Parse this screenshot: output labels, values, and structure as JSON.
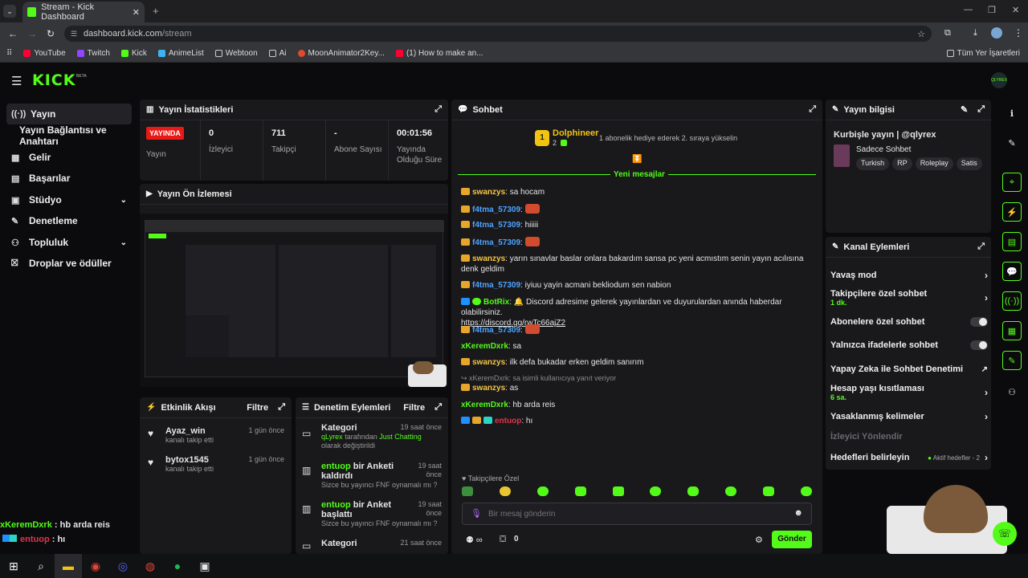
{
  "browser": {
    "tab_title": "Stream - Kick Dashboard",
    "url_domain": "dashboard.kick.com",
    "url_path": "/stream",
    "bookmarks": [
      "YouTube",
      "Twitch",
      "Kick",
      "AnimeList",
      "Webtoon",
      "Ai",
      "MoonAnimator2Key...",
      "(1) How to make an..."
    ],
    "bookmarks_right": "Tüm Yer İşaretleri"
  },
  "header": {
    "logo": "KICK",
    "beta": "BETA",
    "avatar": "QLYREX"
  },
  "sidebar": {
    "items": [
      "Yayın",
      "Yayın Bağlantısı ve Anahtarı",
      "Gelir",
      "Başarılar",
      "Stüdyo",
      "Denetleme",
      "Topluluk",
      "Droplar ve ödüller"
    ]
  },
  "stats": {
    "title": "Yayın İstatistikleri",
    "live_badge": "YAYINDA",
    "live_label": "Yayın",
    "viewers_value": "0",
    "viewers_label": "İzleyici",
    "followers_value": "711",
    "followers_label": "Takipçi",
    "subs_value": "-",
    "subs_label": "Abone Sayısı",
    "uptime_value": "00:01:56",
    "uptime_label": "Yayında Olduğu Süre"
  },
  "preview": {
    "title": "Yayın Ön İzlemesi"
  },
  "activity": {
    "title": "Etkinlik Akışı",
    "filter": "Filtre",
    "items": [
      {
        "user": "Ayaz_win",
        "desc": "kanalı takip etti",
        "time": "1 gün önce"
      },
      {
        "user": "bytox1545",
        "desc": "kanalı takip etti",
        "time": "1 gün önce"
      }
    ]
  },
  "moderation": {
    "title": "Denetim Eylemleri",
    "filter": "Filtre",
    "items": [
      {
        "title": "Kategori",
        "time": "19 saat önce",
        "l1a": "qLyrex",
        "l1b": " tarafından ",
        "l1c": "Just Chatting",
        "l1d": " olarak değiştirildi"
      },
      {
        "user": "entuop",
        "title": " bir Anketi kaldırdı",
        "time": "19 saat önce",
        "sub": "Sizce bu yayıncı FNF oynamalı mı ?"
      },
      {
        "user": "entuop",
        "title": " bir Anket başlattı",
        "time": "19 saat önce",
        "sub": "Sizce bu yayıncı FNF oynamalı mı ?"
      },
      {
        "title": "Kategori",
        "time": "21 saat önce"
      }
    ]
  },
  "chat": {
    "title": "Sohbet",
    "pinned_user": "Dolphineer",
    "pinned_num": "2",
    "gift_rank": "1",
    "pinned_text": "1 abonelik hediye ederek 2. sıraya yükselin",
    "new_messages": "Yeni mesajlar",
    "messages": [
      {
        "user": "swanzys",
        "color": "#f5c542",
        "text": "sa hocam"
      },
      {
        "user": "f4tma_57309",
        "color": "#4fa3ff",
        "text": ""
      },
      {
        "user": "f4tma_57309",
        "color": "#4fa3ff",
        "text": "hiiiii"
      },
      {
        "user": "f4tma_57309",
        "color": "#4fa3ff",
        "text": ""
      },
      {
        "user": "swanzys",
        "color": "#f5c542",
        "text": "yarın sınavlar baslar onlara bakardım sansa pc yeni acmıstım senin yayın acılısına denk geldim"
      },
      {
        "user": "f4tma_57309",
        "color": "#4fa3ff",
        "text": "iyiuu yayin acmani bekliodum sen nabion"
      },
      {
        "user": "BotRix",
        "color": "#53fc18",
        "text": "Discord adresime gelerek yayınlardan ve duyurulardan anında haberdar olabilirsiniz.",
        "link": "https://discord.gg/rwTc66ajZ2"
      },
      {
        "user": "f4tma_57309",
        "color": "#4fa3ff",
        "text": ""
      },
      {
        "user": "xKeremDxrk",
        "color": "#53fc18",
        "text": "sa"
      },
      {
        "user": "swanzys",
        "color": "#f5c542",
        "text": "ilk defa bukadar erken geldim sanırım"
      },
      {
        "user": "swanzys",
        "color": "#f5c542",
        "text": "as",
        "reply": "xKeremDxrk: sa isimli kullanıcıya yanıt veriyor"
      },
      {
        "user": "xKeremDxrk",
        "color": "#53fc18",
        "text": "hb arda reis"
      },
      {
        "user": "entuop",
        "color": "#e0344b",
        "text": "hı"
      }
    ],
    "followers_only": "Takipçilere Özel",
    "input_placeholder": "Bir mesaj gönderin",
    "points": "0",
    "send": "Gönder"
  },
  "stream_info": {
    "title": "Yayın bilgisi",
    "stream_title": "Kurbişle yayın | @qlyrex",
    "category": "Sadece Sohbet",
    "tags": [
      "Turkish",
      "RP",
      "Roleplay",
      "Satis"
    ]
  },
  "channel_actions": {
    "title": "Kanal Eylemleri",
    "items": [
      {
        "label": "Yavaş mod",
        "type": "arrow"
      },
      {
        "label": "Takipçilere özel sohbet",
        "sub": "1 dk.",
        "type": "arrow"
      },
      {
        "label": "Abonelere özel sohbet",
        "type": "toggle"
      },
      {
        "label": "Yalnızca ifadelerle sohbet",
        "type": "toggle"
      },
      {
        "label": "Yapay Zeka ile Sohbet Denetimi",
        "type": "ext"
      },
      {
        "label": "Hesap yaşı kısıtlaması",
        "sub": "6 sa.",
        "type": "arrow"
      },
      {
        "label": "Yasaklanmış kelimeler",
        "type": "arrow"
      },
      {
        "label": "İzleyici Yönlendir",
        "type": "disabled"
      },
      {
        "label": "Hedefleri belirleyin",
        "badge": "Aktif hedefler - 2",
        "type": "arrow"
      }
    ]
  },
  "overlay": {
    "line1_user": "xKeremDxrk",
    "line1_text": " : hb arda reis",
    "line2_user": "entuop",
    "line2_text": " : hı"
  },
  "colors": {
    "accent": "#53fc18",
    "panel": "#19191c",
    "bg": "#0b0b0d",
    "live": "#e91916"
  }
}
